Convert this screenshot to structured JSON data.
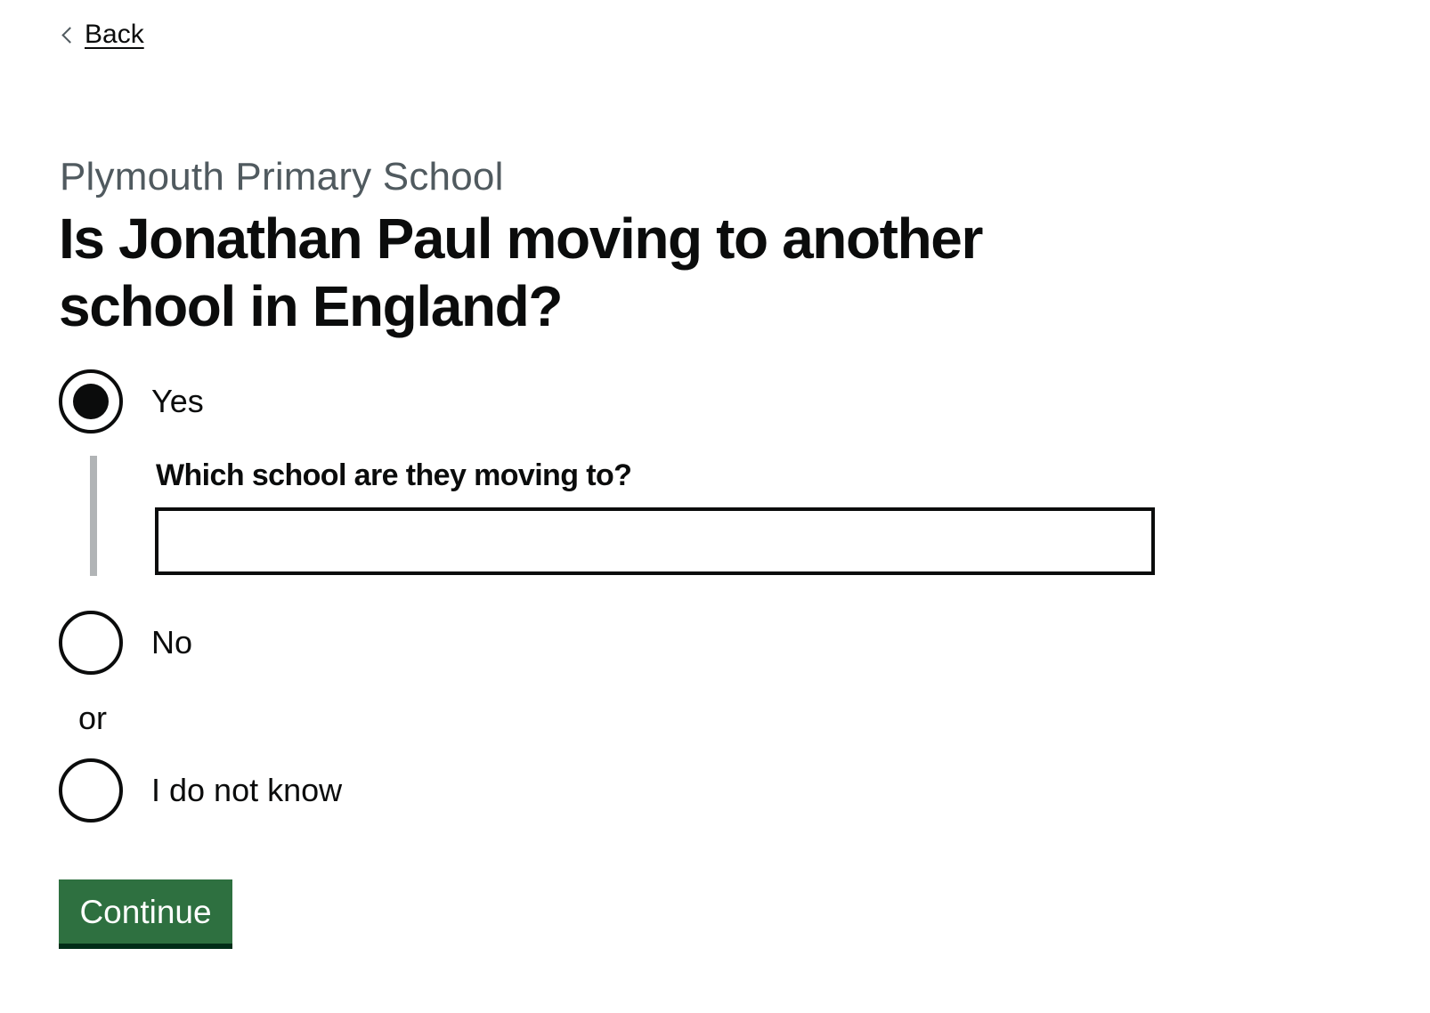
{
  "back_link": {
    "label": "Back"
  },
  "caption": "Plymouth Primary School",
  "question": "Is Jonathan Paul moving to another school in England?",
  "options": [
    {
      "label": "Yes",
      "selected": true
    },
    {
      "label": "No",
      "selected": false
    },
    {
      "label": "I do not know",
      "selected": false
    }
  ],
  "conditional": {
    "label": "Which school are they moving to?",
    "value": ""
  },
  "divider": "or",
  "continue_button": {
    "label": "Continue"
  },
  "colors": {
    "text": "#0b0c0c",
    "secondary_text": "#505a5f",
    "button": "#2e7040",
    "button_shadow": "#002d18",
    "conditional_border": "#b1b4b6"
  }
}
